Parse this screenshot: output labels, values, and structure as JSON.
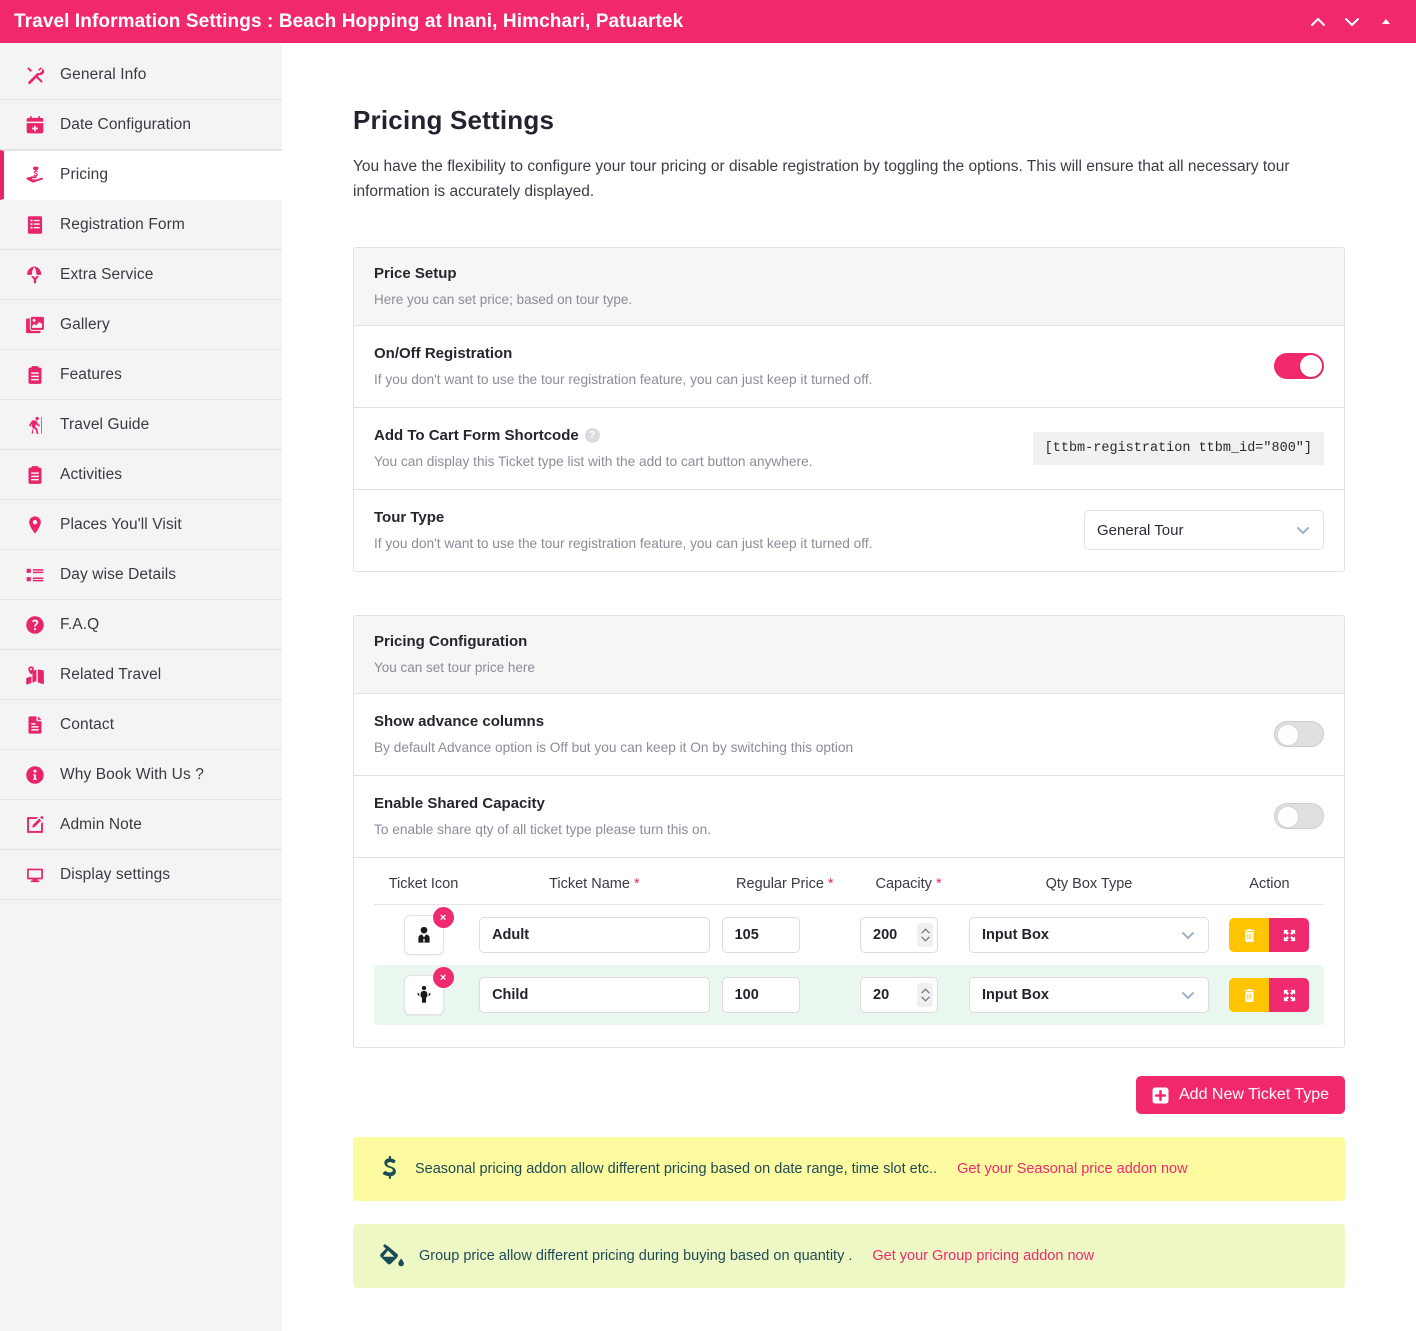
{
  "topbar": {
    "title": "Travel Information Settings : Beach Hopping at Inani, Himchari, Patuartek",
    "icons": [
      "chevron-up-icon",
      "chevron-down-icon",
      "caret-up-icon"
    ],
    "bg_color": "#f2286d"
  },
  "sidebar": {
    "items": [
      {
        "label": "General Info",
        "icon": "tools-icon",
        "active": false
      },
      {
        "label": "Date Configuration",
        "icon": "calendar-plus-icon",
        "active": false
      },
      {
        "label": "Pricing",
        "icon": "hand-money-icon",
        "active": true
      },
      {
        "label": "Registration Form",
        "icon": "form-list-icon",
        "active": false
      },
      {
        "label": "Extra Service",
        "icon": "parachute-icon",
        "active": false
      },
      {
        "label": "Gallery",
        "icon": "images-icon",
        "active": false
      },
      {
        "label": "Features",
        "icon": "clipboard-icon",
        "active": false
      },
      {
        "label": "Travel Guide",
        "icon": "hiking-icon",
        "active": false
      },
      {
        "label": "Activities",
        "icon": "clipboard-icon",
        "active": false
      },
      {
        "label": "Places You'll Visit",
        "icon": "map-marker-icon",
        "active": false
      },
      {
        "label": "Day wise Details",
        "icon": "list-icon",
        "active": false
      },
      {
        "label": "F.A.Q",
        "icon": "question-circle-icon",
        "active": false
      },
      {
        "label": "Related Travel",
        "icon": "map-marked-icon",
        "active": false
      },
      {
        "label": "Contact",
        "icon": "file-lines-icon",
        "active": false
      },
      {
        "label": "Why Book With Us ?",
        "icon": "info-circle-icon",
        "active": false
      },
      {
        "label": "Admin Note",
        "icon": "pen-square-icon",
        "active": false
      },
      {
        "label": "Display settings",
        "icon": "desktop-icon",
        "active": false
      }
    ]
  },
  "main": {
    "title": "Pricing Settings",
    "description": "You have the flexibility to configure your tour pricing or disable registration by toggling the options. This will ensure that all necessary tour information is accurately displayed."
  },
  "price_setup": {
    "header": "Price Setup",
    "subheader": "Here you can set price; based on tour type.",
    "registration": {
      "title": "On/Off Registration",
      "desc": "If you don't want to use the tour registration feature, you can just keep it turned off.",
      "state": "on"
    },
    "shortcode_row": {
      "title": "Add To Cart Form Shortcode",
      "desc": "You can display this Ticket type list with the add to cart button anywhere.",
      "help_icon": "question-circle-icon",
      "value": "[ttbm-registration ttbm_id=\"800\"]"
    },
    "tour_type": {
      "title": "Tour Type",
      "desc": "If you don't want to use the tour registration feature, you can just keep it turned off.",
      "selected": "General Tour",
      "options": [
        "General Tour"
      ]
    }
  },
  "pricing_config": {
    "header": "Pricing Configuration",
    "subheader": "You can set tour price here",
    "advance_columns": {
      "title": "Show advance columns",
      "desc": "By default Advance option is Off but you can keep it On by switching this option",
      "state": "off"
    },
    "shared_capacity": {
      "title": "Enable Shared Capacity",
      "desc": "To enable share qty of all ticket type please turn this on.",
      "state": "off"
    },
    "table": {
      "columns": [
        {
          "label": "Ticket Icon",
          "required": false
        },
        {
          "label": "Ticket Name",
          "required": true
        },
        {
          "label": "Regular Price",
          "required": true
        },
        {
          "label": "Capacity",
          "required": true
        },
        {
          "label": "Qty Box Type",
          "required": false
        },
        {
          "label": "Action",
          "required": false
        }
      ],
      "rows": [
        {
          "icon": "user-tie-icon",
          "remove_badge": "×",
          "name": "Adult",
          "price": "105",
          "capacity": "200",
          "qty_box_type": "Input Box",
          "actions": [
            "trash-icon",
            "expand-arrows-icon"
          ]
        },
        {
          "icon": "child-icon",
          "remove_badge": "×",
          "name": "Child",
          "price": "100",
          "capacity": "20",
          "qty_box_type": "Input Box",
          "actions": [
            "trash-icon",
            "expand-arrows-icon"
          ]
        }
      ]
    }
  },
  "add_ticket_button": {
    "label": "Add New Ticket Type",
    "icon": "plus-square-icon"
  },
  "notices": [
    {
      "icon": "dollar-sign-icon",
      "text": "Seasonal pricing addon allow different pricing based on date range, time slot etc..",
      "link": "Get your Seasonal price addon now",
      "bg_color": "#fdfba0"
    },
    {
      "icon": "fill-drip-icon",
      "text": "Group price allow different pricing during buying based on quantity .",
      "link": "Get your Group pricing addon now",
      "bg_color": "#eef8c4"
    }
  ]
}
